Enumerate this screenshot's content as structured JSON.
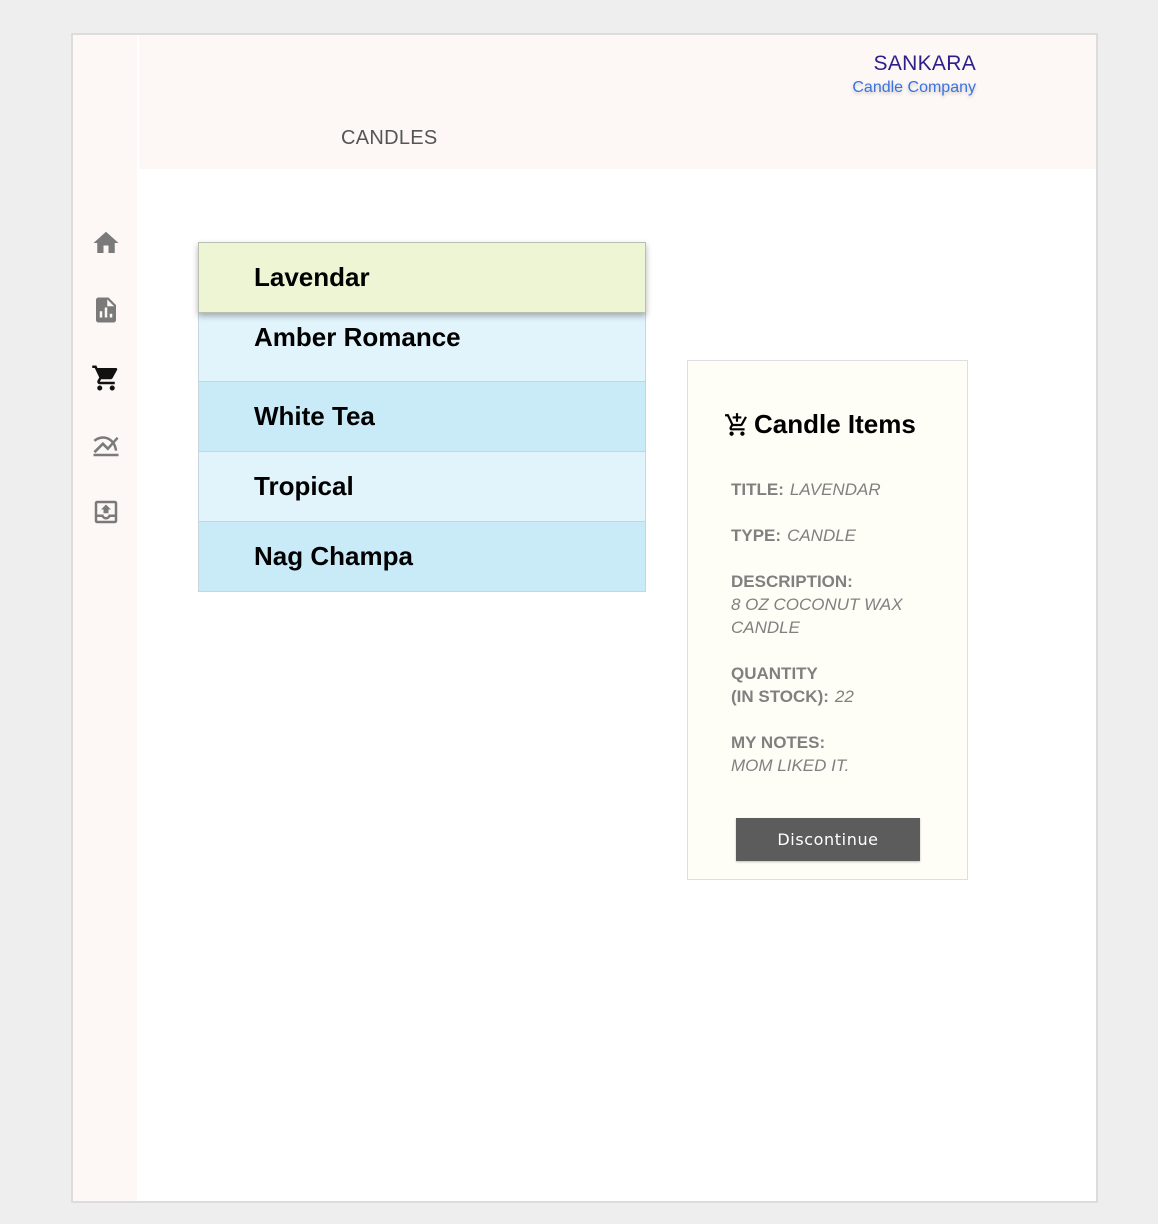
{
  "brand": {
    "name": "SANKARA",
    "subtitle": "Candle Company"
  },
  "page": {
    "title": "CANDLES"
  },
  "sidebar": {
    "items": [
      {
        "icon": "home-icon"
      },
      {
        "icon": "report-icon"
      },
      {
        "icon": "cart-icon"
      },
      {
        "icon": "chart-icon"
      },
      {
        "icon": "upload-icon"
      }
    ]
  },
  "candles": [
    {
      "name": "Lavendar",
      "selected": true
    },
    {
      "name": "Amber Romance",
      "selected": false
    },
    {
      "name": "White Tea",
      "selected": false
    },
    {
      "name": "Tropical",
      "selected": false
    },
    {
      "name": "Nag Champa",
      "selected": false
    }
  ],
  "detail": {
    "icon": "add-to-cart-icon",
    "heading": "Candle Items",
    "title_label": "TITLE:",
    "title_value": "LAVENDAR",
    "type_label": "TYPE:",
    "type_value": "CANDLE",
    "description_label": "DESCRIPTION:",
    "description_value": "8 OZ COCONUT WAX CANDLE",
    "quantity_label_line1": "QUANTITY",
    "quantity_label_line2": "(IN STOCK):",
    "quantity_value": "22",
    "notes_label": "MY NOTES:",
    "notes_value": "MOM LIKED IT.",
    "button_label": "Discontinue"
  },
  "colors": {
    "selected_row": "#eef5d5",
    "light_row": "#e1f3fb",
    "dark_row": "#c9ebf8",
    "brand": "#2c1f8a",
    "brand_sub": "#3b73e0",
    "button": "#5c5c5c"
  }
}
